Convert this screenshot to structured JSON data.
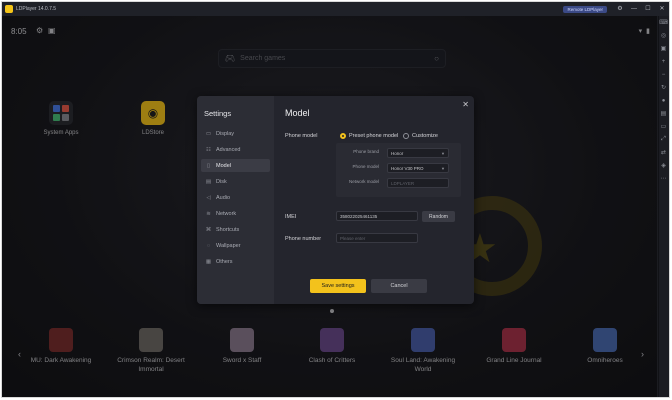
{
  "window": {
    "title": "LDPlayer 14.0.7.5",
    "badge_label": "Remote LDPlayer",
    "controls": [
      "settings-icon",
      "minimize-icon",
      "maximize-icon",
      "close-icon"
    ]
  },
  "statusbar": {
    "time": "8:05"
  },
  "search": {
    "placeholder": "Search games"
  },
  "desktop_apps": [
    {
      "label": "System Apps"
    },
    {
      "label": "LDStore"
    }
  ],
  "games": [
    {
      "name": "MU: Dark Awakening",
      "color": "#7a2e2e"
    },
    {
      "name": "Crimson Realm: Desert Immortal",
      "color": "#6f6a66"
    },
    {
      "name": "Sword x Staff",
      "color": "#8a7a8e"
    },
    {
      "name": "Clash of Critters",
      "color": "#6a4a8a"
    },
    {
      "name": "Soul Land: Awakening World",
      "color": "#4a5ea8"
    },
    {
      "name": "Grand Line Journal",
      "color": "#a8344a"
    },
    {
      "name": "Omniheroes",
      "color": "#4a6ab0"
    }
  ],
  "settings": {
    "title": "Settings",
    "nav": [
      {
        "label": "Display",
        "icon": "display-icon"
      },
      {
        "label": "Advanced",
        "icon": "advanced-icon"
      },
      {
        "label": "Model",
        "icon": "phone-icon",
        "active": true
      },
      {
        "label": "Disk",
        "icon": "disk-icon"
      },
      {
        "label": "Audio",
        "icon": "audio-icon"
      },
      {
        "label": "Network",
        "icon": "wifi-icon"
      },
      {
        "label": "Shortcuts",
        "icon": "shortcuts-icon"
      },
      {
        "label": "Wallpaper",
        "icon": "wallpaper-icon"
      },
      {
        "label": "Others",
        "icon": "grid-icon"
      }
    ]
  },
  "model": {
    "title": "Model",
    "phone_model_label": "Phone model",
    "option_preset": "Preset phone model",
    "option_customize": "Customize",
    "phone_brand_label": "Phone brand",
    "phone_brand_value": "Honor",
    "phone_model_field_label": "Phone model",
    "phone_model_value": "Honor V30 PRO",
    "network_model_label": "Network model",
    "network_model_placeholder": "LDPLAYER",
    "imei_label": "IMEI",
    "imei_value": "358022025461135",
    "random_label": "Random",
    "phone_number_label": "Phone number",
    "phone_number_placeholder": "Please enter",
    "save_label": "Save settings",
    "cancel_label": "Cancel"
  },
  "colors": {
    "accent": "#f3c21c",
    "background": "#17171c",
    "modal": "#24252d"
  }
}
